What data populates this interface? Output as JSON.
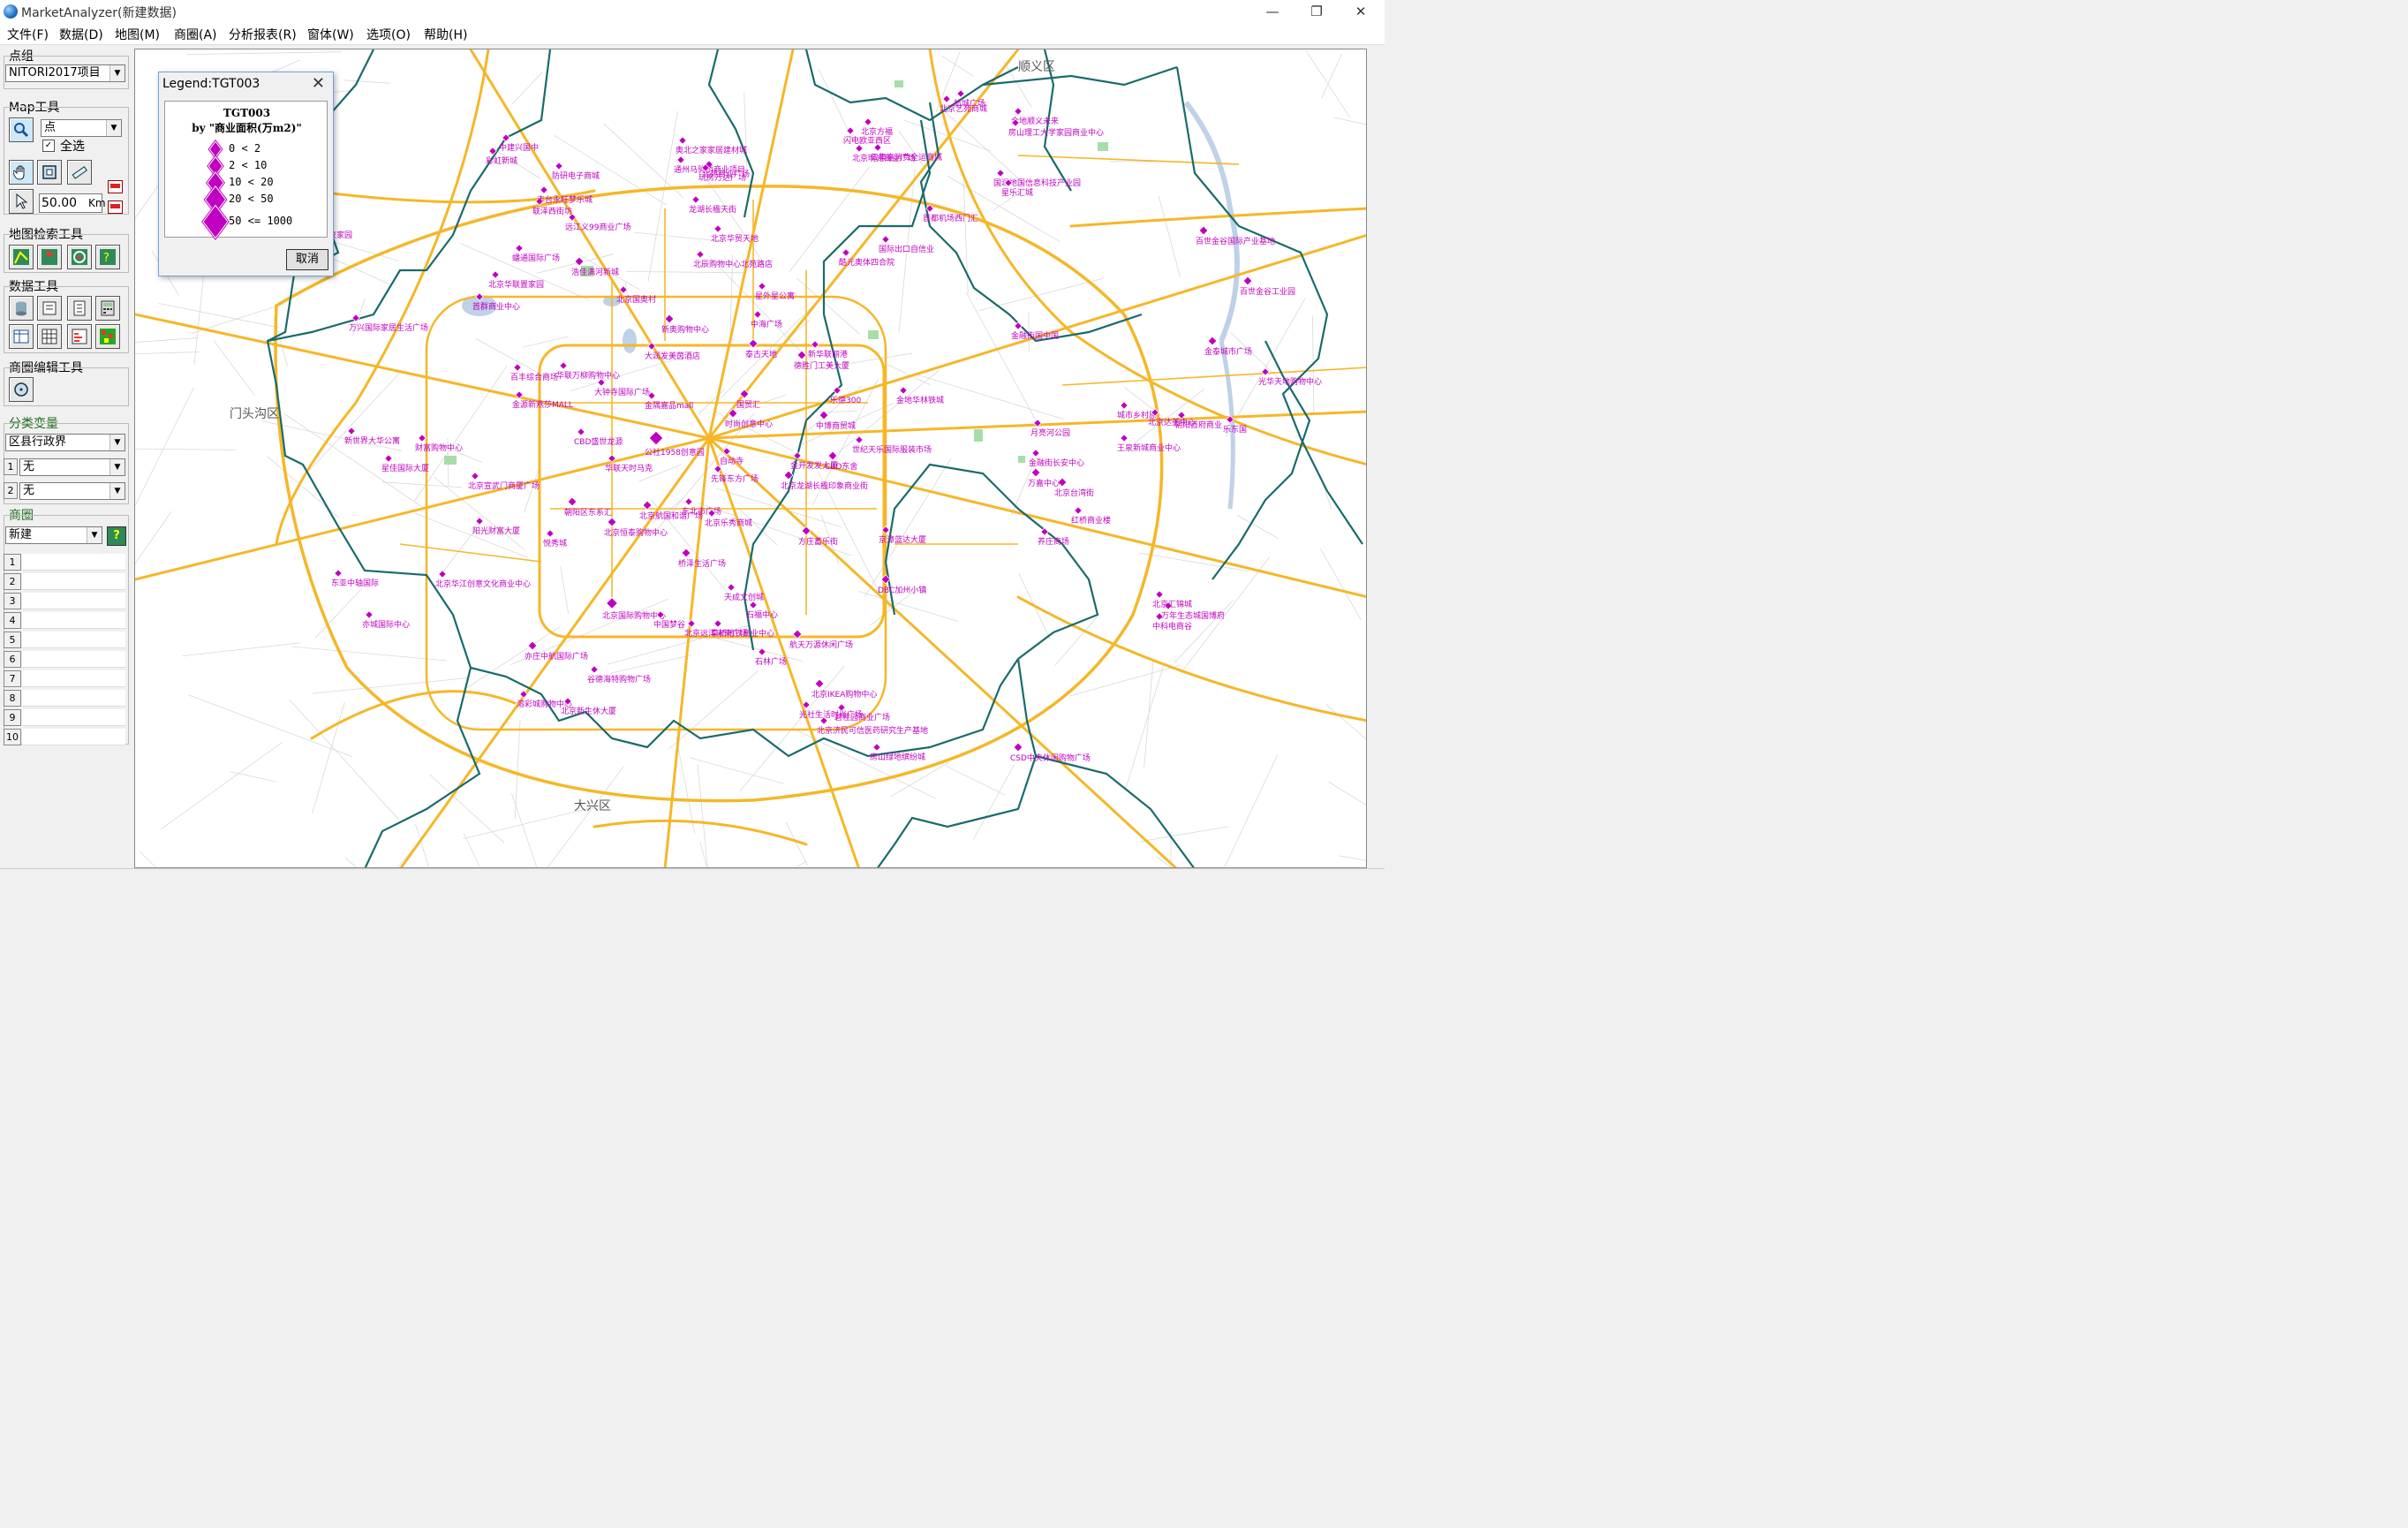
{
  "window": {
    "title": "MarketAnalyzer(新建数据)",
    "min": "—",
    "restore": "❐",
    "close": "✕"
  },
  "menu": [
    "文件(F)",
    "数据(D)",
    "地图(M)",
    "商圈(A)",
    "分析报表(R)",
    "窗体(W)",
    "选项(O)",
    "帮助(H)"
  ],
  "sidebar": {
    "point_group": {
      "title": "点组",
      "value": "NITORI2017项目"
    },
    "map_tools": {
      "title": "Map工具",
      "layer_value": "点",
      "select_all_label": "全选",
      "radius_value": "50.00",
      "radius_unit": "Km"
    },
    "map_search": {
      "title": "地图检索工具"
    },
    "data_tools": {
      "title": "数据工具"
    },
    "area_edit": {
      "title": "商圈编辑工具"
    },
    "class_var": {
      "title": "分类变量",
      "value": "区县行政界",
      "row1_label": "1",
      "row1_value": "无",
      "row2_label": "2",
      "row2_value": "无"
    },
    "trade_area": {
      "title": "商圈",
      "value": "新建",
      "help": "?",
      "rows": [
        "1",
        "2",
        "3",
        "4",
        "5",
        "6",
        "7",
        "8",
        "9",
        "10"
      ]
    }
  },
  "legend": {
    "window_title": "Legend:TGT003",
    "heading": "TGT003",
    "subheading": "by \"商业面积(万m2)\"",
    "classes": [
      "0 < 2",
      "2 < 10",
      "10 < 20",
      "20 < 50",
      "50 <= 1000"
    ],
    "cancel_label": "取消"
  },
  "map": {
    "district_labels": [
      "门头沟区",
      "大兴区",
      "顺义区"
    ],
    "marker_color": "#c000c0",
    "road_color": "#f5b728",
    "boundary_color": "#1a6b6b",
    "pois": [
      "中建兴国中",
      "奥北之家家居建材城",
      "北京方福",
      "航城广场",
      "金地顺义未来",
      "闪电欧亚西区",
      "防研电子商城",
      "北苑商业广场",
      "国润地国信息科技产业园",
      "国际出口自信业",
      "联泽西街坊",
      "龙湖长楹天街",
      "首都机场西门汇",
      "远江义99商业广场",
      "北京通泉家园",
      "北京华贸天地",
      "百世金谷国际产业基地",
      "蟠通国际广场",
      "浩佳满河新城",
      "北辰购物中心北苑路店",
      "酷元奥体四合院",
      "北京华联置家园",
      "北京国奥村",
      "百世金谷工业园",
      "星外星公寓",
      "首群商业中心",
      "新奥购物中心",
      "中海广场",
      "金融街国中国",
      "万兴国际家居生活广场",
      "大润发美茵酒店",
      "泰古天地",
      "金泰城市广场",
      "华联万柳购物中心",
      "大钟寺国际广场",
      "新华联丽港",
      "光华天地购物中心",
      "百丰综合商场",
      "金源新燕莎MALL",
      "德胜门工美大厦",
      "乐德300",
      "金隅嘉品mall",
      "国贸汇",
      "金地华林铁城",
      "月亮河公园",
      "城市乡村原",
      "朝阳首府商业",
      "时尚创意中心",
      "北京达美中心",
      "乐东国",
      "中博商贸城",
      "王泉新城商业中心",
      "世纪天乐国际服装市场",
      "新世界大华公寓",
      "财富购物中心",
      "CBD盛世龙源",
      "公社1958创意园",
      "自动寺",
      "金开发发大厦",
      "CBD东舍",
      "北京龙湖长楹印象商业街",
      "星佳国际大厦",
      "华联天时马克",
      "金融街长安中心",
      "北京台湾街",
      "先锋东方广场",
      "万嘉中心",
      "北京宣武门商厦广场",
      "朝阳区东系汇",
      "东北市广场",
      "养庄商场",
      "北京航国和谐广场",
      "北京乐秀商城",
      "红桥商业楼",
      "阳光财富大厦",
      "北京恒泰购物中心",
      "方庄蓄乐街",
      "悦秀城",
      "桥泽生活广场",
      "京漳蓝达大厦",
      "天成文创城",
      "DBC加州小镇",
      "东亚中轴国际",
      "北京华江创意文化商业中心",
      "石福中心",
      "草桥地铁商业中心",
      "万年生态城国博府",
      "北京汇锦城",
      "北京国际购物中心",
      "北京远洋未来广场",
      "中科电商谷",
      "亦城国际中心",
      "中国梦谷",
      "航天万源休闲广场",
      "石林广场",
      "谷德海特购物广场",
      "北京IKEA购物中心",
      "亦庄中航国际广场",
      "溶彩城购物中心",
      "北京新生休大厦",
      "光社生活时尚广场",
      "碧桂园商业广场",
      "房山绿地缤纷城",
      "CSD中央休闲购物广场",
      "北京济民可信医药研究生产基地",
      "彩虹新城",
      "通州马驹桥商业项目",
      "云集嘉消费全运商城",
      "北京艺苑商城",
      "房山理工大学家园商业中心",
      "北京明光商业广场",
      "丰台永旺梦乐城",
      "玩房万达广场",
      "星乐汇城"
    ]
  }
}
